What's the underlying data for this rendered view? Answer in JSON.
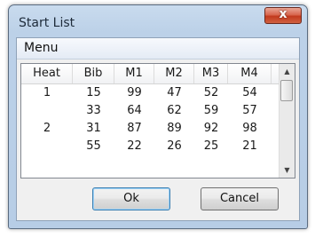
{
  "window": {
    "title": "Start List",
    "close_glyph": "x"
  },
  "menu": {
    "items": [
      "Menu"
    ]
  },
  "table": {
    "columns": [
      "Heat",
      "Bib",
      "M1",
      "M2",
      "M3",
      "M4"
    ],
    "rows": [
      [
        "1",
        "15",
        "99",
        "47",
        "52",
        "54"
      ],
      [
        "",
        "33",
        "64",
        "62",
        "59",
        "57"
      ],
      [
        "2",
        "31",
        "87",
        "89",
        "92",
        "98"
      ],
      [
        "",
        "55",
        "22",
        "26",
        "25",
        "21"
      ]
    ]
  },
  "scrollbar": {
    "up_icon": "▲",
    "down_icon": "▼"
  },
  "buttons": {
    "ok": "Ok",
    "cancel": "Cancel"
  },
  "colors": {
    "close_button": "#c23a1e",
    "window_frame": "#b7cde6"
  }
}
